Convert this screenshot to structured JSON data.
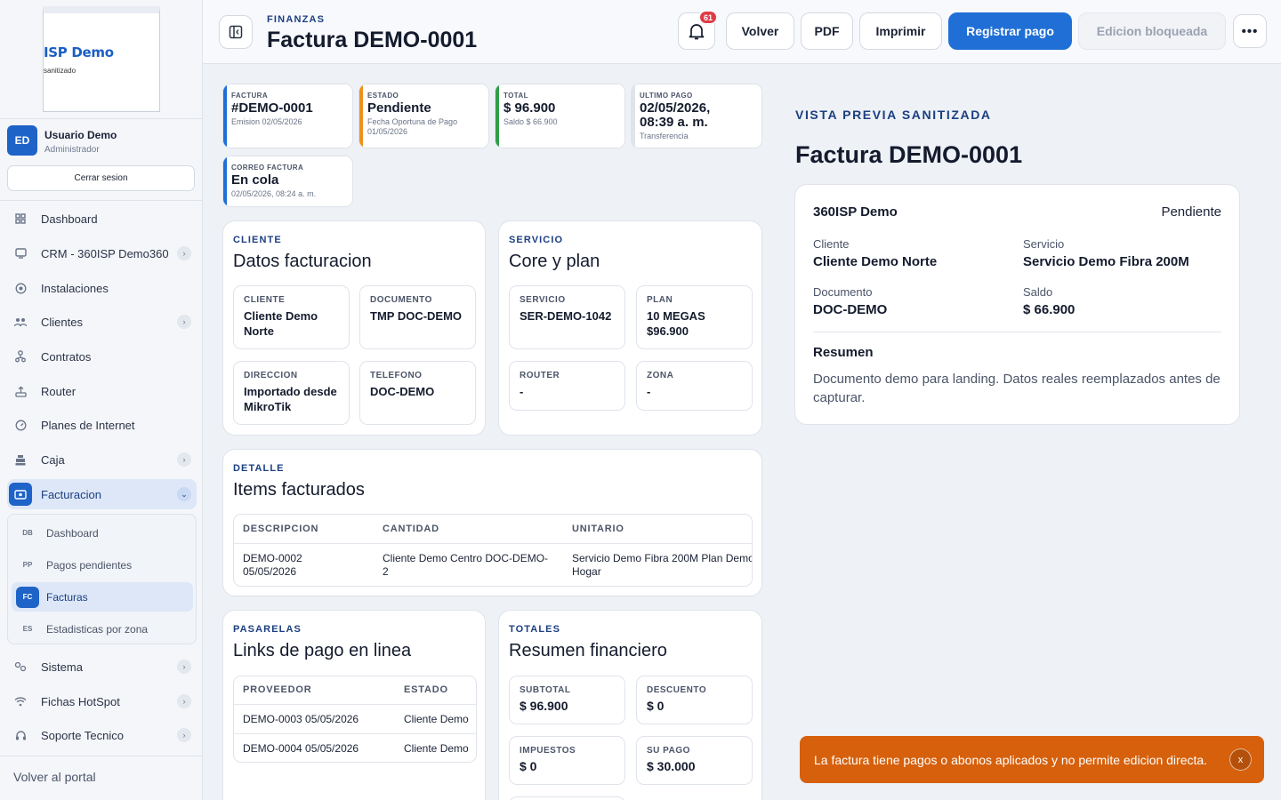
{
  "brand": {
    "name": "ISP Demo",
    "tagline": "sanitizado"
  },
  "user": {
    "initials": "ED",
    "name": "Usuario Demo",
    "role": "Administrador",
    "logout": "Cerrar sesion"
  },
  "nav": [
    {
      "label": "Dashboard",
      "icon": "grid-icon"
    },
    {
      "label": "CRM - 360ISP Demo360",
      "icon": "crm-icon",
      "chev": true
    },
    {
      "label": "Instalaciones",
      "icon": "target-icon"
    },
    {
      "label": "Clientes",
      "icon": "users-icon",
      "chev": true
    },
    {
      "label": "Contratos",
      "icon": "contract-icon"
    },
    {
      "label": "Router",
      "icon": "router-icon"
    },
    {
      "label": "Planes de Internet",
      "icon": "speed-icon"
    },
    {
      "label": "Caja",
      "icon": "cash-register-icon",
      "chev": true
    },
    {
      "label": "Facturacion",
      "icon": "invoice-icon",
      "chev": true,
      "active": true
    },
    {
      "label": "Sistema",
      "icon": "settings-icon",
      "chev": true
    },
    {
      "label": "Fichas HotSpot",
      "icon": "wifi-icon",
      "chev": true
    },
    {
      "label": "Soporte Tecnico",
      "icon": "headset-icon",
      "chev": true
    }
  ],
  "submenu": [
    {
      "code": "DB",
      "label": "Dashboard"
    },
    {
      "code": "PP",
      "label": "Pagos pendientes"
    },
    {
      "code": "FC",
      "label": "Facturas",
      "active": true
    },
    {
      "code": "ES",
      "label": "Estadisticas por zona"
    }
  ],
  "portal_link": "Volver al portal",
  "header": {
    "crumb": "FINANZAS",
    "title": "Factura DEMO-0001",
    "notifications": "61",
    "buttons": {
      "back": "Volver",
      "pdf": "PDF",
      "print": "Imprimir",
      "pay": "Registrar pago",
      "locked": "Edicion bloqueada"
    }
  },
  "summary": [
    {
      "label": "FACTURA",
      "value": "#DEMO-0001",
      "sub": "Emision 02/05/2026",
      "color": "#1f6fd6"
    },
    {
      "label": "ESTADO",
      "value": "Pendiente",
      "sub": "Fecha Oportuna de Pago 01/05/2026",
      "color": "#f0901a"
    },
    {
      "label": "TOTAL",
      "value": "$ 96.900",
      "sub": "Saldo $ 66.900",
      "color": "#2f9e44"
    },
    {
      "label": "ULTIMO PAGO",
      "value": "02/05/2026, 08:39 a. m.",
      "sub": "Transferencia",
      "color": "#dfe3ea"
    },
    {
      "label": "CORREO FACTURA",
      "value": "En cola",
      "sub": "02/05/2026, 08:24 a. m.",
      "color": "#1f6fd6"
    }
  ],
  "cliente": {
    "eyebrow": "CLIENTE",
    "title": "Datos facturacion",
    "fields": [
      {
        "label": "CLIENTE",
        "value": "Cliente Demo Norte"
      },
      {
        "label": "DOCUMENTO",
        "value": "TMP DOC-DEMO"
      },
      {
        "label": "DIRECCION",
        "value": "Importado desde MikroTik"
      },
      {
        "label": "TELEFONO",
        "value": "DOC-DEMO"
      }
    ]
  },
  "servicio": {
    "eyebrow": "SERVICIO",
    "title": "Core y plan",
    "fields": [
      {
        "label": "SERVICIO",
        "value": "SER-DEMO-1042"
      },
      {
        "label": "PLAN",
        "value": "10 MEGAS $96.900"
      },
      {
        "label": "ROUTER",
        "value": "-"
      },
      {
        "label": "ZONA",
        "value": "-"
      }
    ]
  },
  "detalle": {
    "eyebrow": "DETALLE",
    "title": "Items facturados",
    "columns": [
      "DESCRIPCION",
      "CANTIDAD",
      "UNITARIO"
    ],
    "rows": [
      [
        "DEMO-0002",
        "05/05/2026",
        "Cliente Demo Centro DOC-DEMO-",
        "2",
        "Servicio Demo Fibra 200M Plan Demo",
        "Hogar"
      ]
    ]
  },
  "pasarelas": {
    "eyebrow": "PASARELAS",
    "title": "Links de pago en linea",
    "columns": [
      "PROVEEDOR",
      "ESTADO"
    ],
    "rows": [
      [
        "DEMO-0003 05/05/2026",
        "Cliente Demo"
      ],
      [
        "DEMO-0004 05/05/2026",
        "Cliente Demo"
      ]
    ]
  },
  "totales": {
    "eyebrow": "TOTALES",
    "title": "Resumen financiero",
    "fields": [
      {
        "label": "SUBTOTAL",
        "value": "$ 96.900"
      },
      {
        "label": "DESCUENTO",
        "value": "$ 0"
      },
      {
        "label": "IMPUESTOS",
        "value": "$ 0"
      },
      {
        "label": "SU PAGO",
        "value": "$ 30.000"
      }
    ]
  },
  "preview": {
    "eyebrow": "VISTA PREVIA SANITIZADA",
    "title": "Factura DEMO-0001",
    "company": "360ISP Demo",
    "status": "Pendiente",
    "cliente_label": "Cliente",
    "cliente": "Cliente Demo Norte",
    "servicio_label": "Servicio",
    "servicio": "Servicio Demo Fibra 200M",
    "documento_label": "Documento",
    "documento": "DOC-DEMO",
    "saldo_label": "Saldo",
    "saldo": "$ 66.900",
    "resumen_label": "Resumen",
    "resumen": "Documento demo para landing. Datos reales reemplazados antes de capturar."
  },
  "toast": {
    "message": "La factura tiene pagos o abonos aplicados y no permite edicion directa.",
    "close": "x"
  }
}
